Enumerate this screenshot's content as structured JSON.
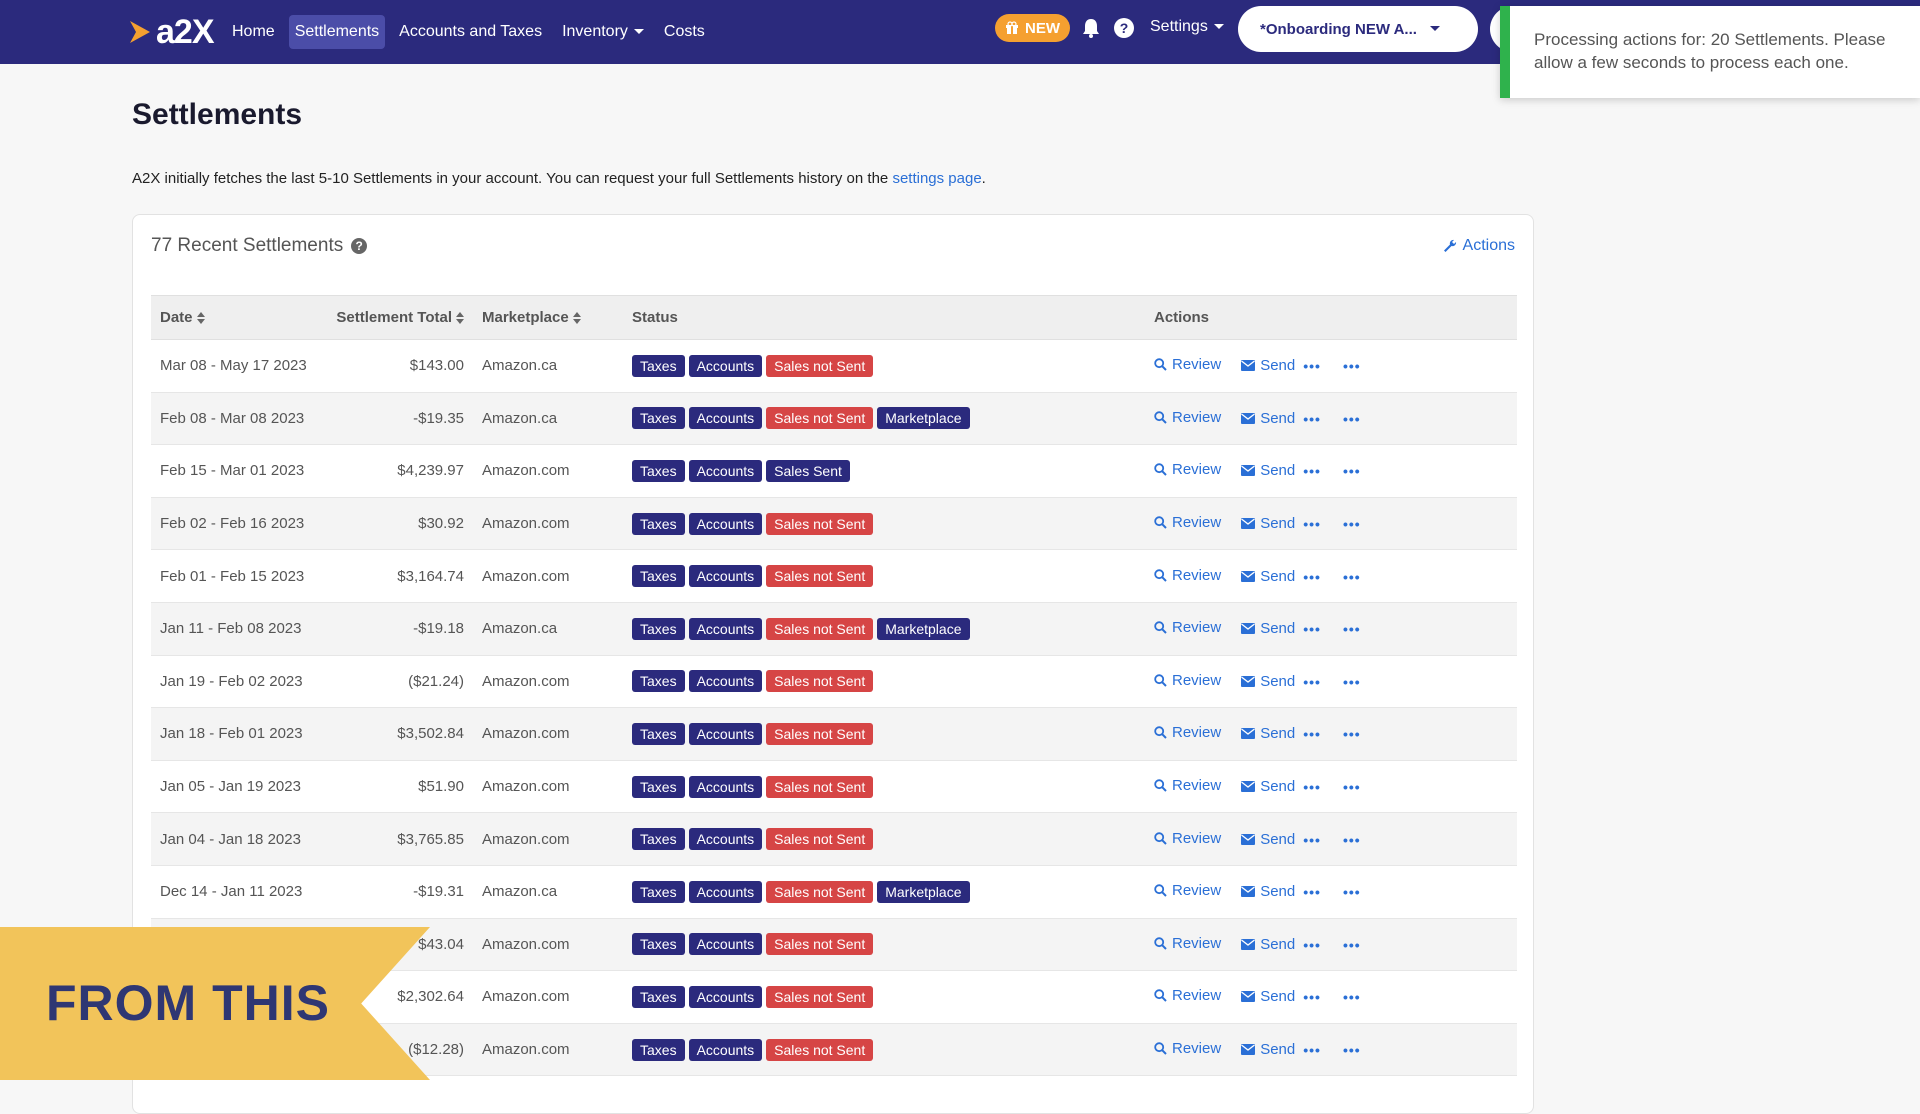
{
  "nav": {
    "logo_text": "a2X",
    "links": [
      {
        "label": "Home",
        "active": false,
        "dropdown": false
      },
      {
        "label": "Settlements",
        "active": true,
        "dropdown": false
      },
      {
        "label": "Accounts and Taxes",
        "active": false,
        "dropdown": false
      },
      {
        "label": "Inventory",
        "active": false,
        "dropdown": true
      },
      {
        "label": "Costs",
        "active": false,
        "dropdown": false
      }
    ],
    "new_badge": "NEW",
    "help_glyph": "?",
    "settings_label": "Settings",
    "org_label": "*Onboarding NEW A..."
  },
  "toast": {
    "message": "Processing actions for: 20 Settlements. Please allow a few seconds to process each one."
  },
  "page": {
    "title": "Settlements",
    "intro_text": "A2X initially fetches the last 5-10 Settlements in your account. You can request your full Settlements history on the ",
    "intro_link": "settings page",
    "intro_end": "."
  },
  "panel": {
    "heading": "77 Recent Settlements",
    "help_glyph": "?",
    "actions_label": "Actions"
  },
  "table": {
    "headers": {
      "date": "Date",
      "total": "Settlement Total",
      "marketplace": "Marketplace",
      "status": "Status",
      "actions": "Actions"
    },
    "review_label": "Review",
    "send_label": "Send",
    "rows": [
      {
        "date": "Mar 08 - May 17 2023",
        "total": "$143.00",
        "marketplace": "Amazon.ca",
        "badges": [
          "Taxes",
          "Accounts",
          "Sales not Sent"
        ]
      },
      {
        "date": "Feb 08 - Mar 08 2023",
        "total": "-$19.35",
        "marketplace": "Amazon.ca",
        "badges": [
          "Taxes",
          "Accounts",
          "Sales not Sent",
          "Marketplace"
        ]
      },
      {
        "date": "Feb 15 - Mar 01 2023",
        "total": "$4,239.97",
        "marketplace": "Amazon.com",
        "badges": [
          "Taxes",
          "Accounts",
          "Sales Sent"
        ]
      },
      {
        "date": "Feb 02 - Feb 16 2023",
        "total": "$30.92",
        "marketplace": "Amazon.com",
        "badges": [
          "Taxes",
          "Accounts",
          "Sales not Sent"
        ]
      },
      {
        "date": "Feb 01 - Feb 15 2023",
        "total": "$3,164.74",
        "marketplace": "Amazon.com",
        "badges": [
          "Taxes",
          "Accounts",
          "Sales not Sent"
        ]
      },
      {
        "date": "Jan 11 - Feb 08 2023",
        "total": "-$19.18",
        "marketplace": "Amazon.ca",
        "badges": [
          "Taxes",
          "Accounts",
          "Sales not Sent",
          "Marketplace"
        ]
      },
      {
        "date": "Jan 19 - Feb 02 2023",
        "total": "($21.24)",
        "marketplace": "Amazon.com",
        "badges": [
          "Taxes",
          "Accounts",
          "Sales not Sent"
        ]
      },
      {
        "date": "Jan 18 - Feb 01 2023",
        "total": "$3,502.84",
        "marketplace": "Amazon.com",
        "badges": [
          "Taxes",
          "Accounts",
          "Sales not Sent"
        ]
      },
      {
        "date": "Jan 05 - Jan 19 2023",
        "total": "$51.90",
        "marketplace": "Amazon.com",
        "badges": [
          "Taxes",
          "Accounts",
          "Sales not Sent"
        ]
      },
      {
        "date": "Jan 04 - Jan 18 2023",
        "total": "$3,765.85",
        "marketplace": "Amazon.com",
        "badges": [
          "Taxes",
          "Accounts",
          "Sales not Sent"
        ]
      },
      {
        "date": "Dec 14 - Jan 11 2023",
        "total": "-$19.31",
        "marketplace": "Amazon.ca",
        "badges": [
          "Taxes",
          "Accounts",
          "Sales not Sent",
          "Marketplace"
        ]
      },
      {
        "date": "",
        "total": "$43.04",
        "marketplace": "Amazon.com",
        "badges": [
          "Taxes",
          "Accounts",
          "Sales not Sent"
        ]
      },
      {
        "date": "",
        "total": "$2,302.64",
        "marketplace": "Amazon.com",
        "badges": [
          "Taxes",
          "Accounts",
          "Sales not Sent"
        ]
      },
      {
        "date": "",
        "total": "($12.28)",
        "marketplace": "Amazon.com",
        "badges": [
          "Taxes",
          "Accounts",
          "Sales not Sent"
        ]
      }
    ]
  },
  "banner": {
    "text": "FROM THIS"
  },
  "colors": {
    "nav_bg": "#2b2a7d",
    "badge_navy": "#2b2a7d",
    "badge_red": "#d64545",
    "link_blue": "#2a6fd6",
    "toast_accent": "#2fb24c",
    "banner_bg": "#f2c45a",
    "new_badge": "#f5a030"
  },
  "icons": {
    "logo": "a2x-logo-arrow-icon",
    "gift": "gift-icon",
    "bell": "bell-icon",
    "help": "question-circle-icon",
    "wrench": "wrench-icon",
    "search": "search-icon",
    "envelope": "envelope-icon",
    "ellipsis": "ellipsis-icon"
  }
}
